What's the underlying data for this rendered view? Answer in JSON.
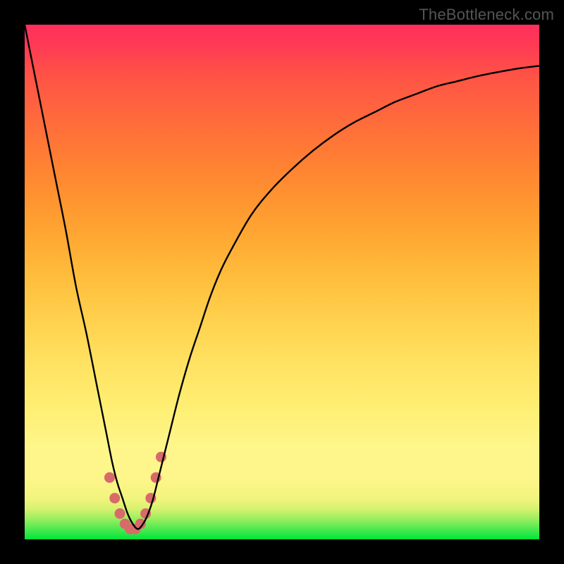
{
  "watermark": "TheBottleneck.com",
  "colors": {
    "frame": "#000000",
    "curve": "#000000",
    "marker": "#d86a6a",
    "gradient_stops": [
      "#00e63b",
      "#fef68a",
      "#ffc03e",
      "#ff693c",
      "#ff2f5d"
    ]
  },
  "chart_data": {
    "type": "line",
    "title": "",
    "xlabel": "",
    "ylabel": "",
    "xlim": [
      0,
      100
    ],
    "ylim": [
      0,
      100
    ],
    "grid": false,
    "legend": false,
    "x": [
      0,
      2,
      4,
      6,
      8,
      10,
      12,
      14,
      15,
      16,
      17,
      18,
      19,
      20,
      21,
      22,
      23,
      24,
      25,
      26,
      28,
      30,
      32,
      34,
      36,
      38,
      40,
      44,
      48,
      52,
      56,
      60,
      64,
      68,
      72,
      76,
      80,
      84,
      88,
      92,
      96,
      100
    ],
    "y": [
      100,
      90,
      80,
      70,
      60,
      49,
      40,
      30,
      25,
      20,
      15,
      11,
      8,
      5,
      3,
      2,
      3,
      5,
      8,
      12,
      20,
      28,
      35,
      41,
      47,
      52,
      56,
      63,
      68,
      72,
      75.5,
      78.5,
      81,
      83,
      85,
      86.5,
      88,
      89,
      90,
      90.8,
      91.5,
      92
    ],
    "markers": {
      "note": "thick salmon dots near the valley",
      "x": [
        16.5,
        17.5,
        18.5,
        19.5,
        20.5,
        21.5,
        22.5,
        23.5,
        24.5,
        25.5,
        26.5
      ],
      "y": [
        12,
        8,
        5,
        3,
        2,
        2,
        3,
        5,
        8,
        12,
        16
      ]
    },
    "description": "Single black V-shaped curve on a vertical green-to-red gradient. Steep nearly linear descent from top-left to a minimum near x≈21, then a concave asymptotic rise toward the upper right. No axes, ticks, labels, or legend are drawn."
  }
}
